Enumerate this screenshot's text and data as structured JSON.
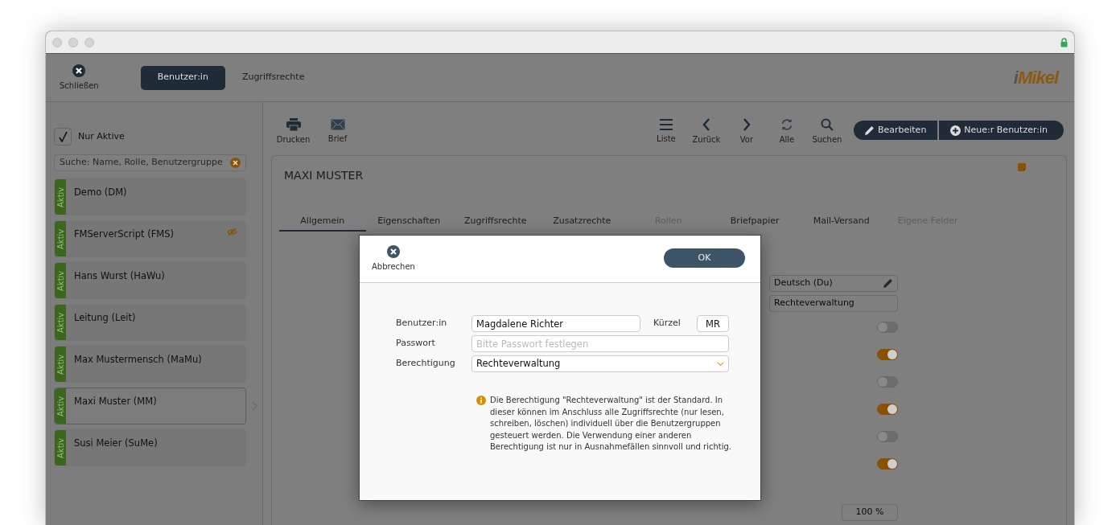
{
  "topbar": {
    "close_label": "Schließen",
    "tabs": [
      {
        "label": "Benutzer:in",
        "selected": true
      },
      {
        "label": "Zugriffsrechte",
        "selected": false
      }
    ],
    "logo": "iMikel"
  },
  "sidebar": {
    "filter": {
      "label": "Nur Aktive",
      "checked": true
    },
    "search": {
      "placeholder": "Suche: Name, Rolle, Benutzergruppe"
    },
    "users": [
      {
        "name": "Demo (DM)",
        "status": "Aktiv",
        "hidden": false,
        "selected": false
      },
      {
        "name": "FMServerScript (FMS)",
        "status": "Aktiv",
        "hidden": true,
        "selected": false
      },
      {
        "name": "Hans Wurst (HaWu)",
        "status": "Aktiv",
        "hidden": false,
        "selected": false
      },
      {
        "name": "Leitung (Leit)",
        "status": "Aktiv",
        "hidden": false,
        "selected": false
      },
      {
        "name": "Max Mustermensch (MaMu)",
        "status": "Aktiv",
        "hidden": false,
        "selected": false
      },
      {
        "name": "Maxi Muster (MM)",
        "status": "Aktiv",
        "hidden": false,
        "selected": true
      },
      {
        "name": "Susi Meier (SuMe)",
        "status": "Aktiv",
        "hidden": false,
        "selected": false
      }
    ]
  },
  "main": {
    "tools_left": [
      {
        "label": "Drucken",
        "kind": "print"
      },
      {
        "label": "Brief",
        "kind": "mail"
      }
    ],
    "tools_right": [
      {
        "label": "Liste",
        "kind": "list"
      },
      {
        "label": "Zurück",
        "kind": "back"
      },
      {
        "label": "Vor",
        "kind": "forward"
      },
      {
        "label": "Alle",
        "kind": "refresh"
      },
      {
        "label": "Suchen",
        "kind": "search"
      }
    ],
    "actions": [
      {
        "label": "Bearbeiten",
        "kind": "pencil"
      },
      {
        "label": "Neue:r Benutzer:in",
        "kind": "plus"
      }
    ],
    "record": {
      "title": "MAXI MUSTER",
      "tabs": [
        {
          "label": "Allgemein",
          "selected": true,
          "disabled": false
        },
        {
          "label": "Eigenschaften",
          "selected": false,
          "disabled": false
        },
        {
          "label": "Zugriffsrechte",
          "selected": false,
          "disabled": false
        },
        {
          "label": "Zusatzrechte",
          "selected": false,
          "disabled": false
        },
        {
          "label": "Rollen",
          "selected": false,
          "disabled": true
        },
        {
          "label": "Briefpapier",
          "selected": false,
          "disabled": false
        },
        {
          "label": "Mail-Versand",
          "selected": false,
          "disabled": false
        },
        {
          "label": "Eigene Felder",
          "selected": false,
          "disabled": true
        }
      ],
      "fields": [
        {
          "kind": "field",
          "value": "Deutsch (Du)",
          "editable": true
        },
        {
          "kind": "field",
          "value": "Rechteverwaltung",
          "editable": false
        },
        {
          "kind": "toggle",
          "on": false
        },
        {
          "kind": "toggle",
          "on": true
        },
        {
          "kind": "toggle",
          "on": false
        },
        {
          "kind": "toggle",
          "on": true
        },
        {
          "kind": "toggle",
          "on": false
        },
        {
          "kind": "toggle",
          "on": true
        },
        {
          "kind": "number",
          "value": "100 %"
        }
      ]
    }
  },
  "dialog": {
    "cancel_label": "Abbrechen",
    "ok_label": "OK",
    "name": {
      "label": "Benutzer:in",
      "value": "Magdalene Richter"
    },
    "abbreviation": {
      "label": "Kürzel",
      "value": "MR"
    },
    "password": {
      "label": "Passwort",
      "placeholder": "Bitte Passwort festlegen"
    },
    "permission": {
      "label": "Berechtigung",
      "value": "Rechteverwaltung"
    },
    "info": "Die Berechtigung \"Rechteverwaltung\" ist der Standard. In dieser können im Anschluss alle Zugriffsrechte (nur lesen, schreiben, löschen) individuell über die Benutzergruppen gesteuert werden. Die Verwendung einer anderen Berechtigung ist nur in Ausnahmefällen sinnvoll und richtig."
  }
}
